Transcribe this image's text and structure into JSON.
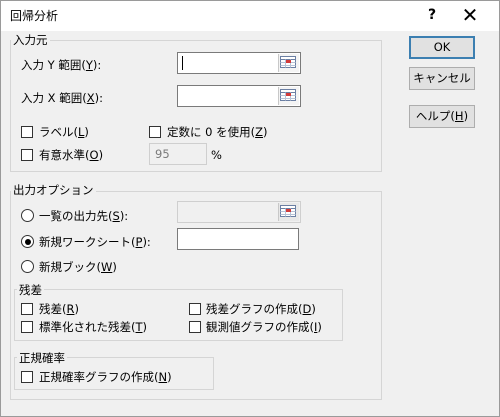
{
  "window": {
    "title": "回帰分析",
    "help_glyph": "?",
    "close_glyph": "✕"
  },
  "input": {
    "legend": "入力元",
    "y_range": {
      "label": "入力 Y 範囲(",
      "key": "Y",
      "end": "):",
      "value": ""
    },
    "x_range": {
      "label": "入力 X 範囲(",
      "key": "X",
      "end": "):",
      "value": ""
    },
    "labels_cb": {
      "label": "ラベル(",
      "key": "L",
      "end": ")",
      "checked": false
    },
    "constant_zero_cb": {
      "label": "定数に 0 を使用(",
      "key": "Z",
      "end": ")",
      "checked": false
    },
    "confidence_cb": {
      "label": "有意水準(",
      "key": "O",
      "end": ")",
      "checked": false
    },
    "confidence_value": "95",
    "confidence_unit": "%"
  },
  "output": {
    "legend": "出力オプション",
    "range_rb": {
      "label": "一覧の出力先(",
      "key": "S",
      "end": "):",
      "selected": false,
      "value": ""
    },
    "new_sheet_rb": {
      "label": "新規ワークシート(",
      "key": "P",
      "end": "):",
      "selected": true,
      "value": ""
    },
    "new_book_rb": {
      "label": "新規ブック(",
      "key": "W",
      "end": ")",
      "selected": false
    }
  },
  "residuals": {
    "legend": "残差",
    "residuals_cb": {
      "label": "残差(",
      "key": "R",
      "end": ")",
      "checked": false
    },
    "residual_plots_cb": {
      "label": "残差グラフの作成(",
      "key": "D",
      "end": ")",
      "checked": false
    },
    "standardized_cb": {
      "label": "標準化された残差(",
      "key": "T",
      "end": ")",
      "checked": false
    },
    "line_fit_cb": {
      "label": "観測値グラフの作成(",
      "key": "I",
      "end": ")",
      "checked": false
    }
  },
  "normal_probability": {
    "legend": "正規確率",
    "plots_cb": {
      "label": "正規確率グラフの作成(",
      "key": "N",
      "end": ")",
      "checked": false
    }
  },
  "buttons": {
    "ok": "OK",
    "cancel": "キャンセル",
    "help": {
      "label": "ヘルプ(",
      "key": "H",
      "end": ")"
    }
  },
  "colors": {
    "default_button_border": "#3c7fb1",
    "dialog_bg": "#f0f0f0",
    "titlebar_bg": "#ffffff"
  }
}
